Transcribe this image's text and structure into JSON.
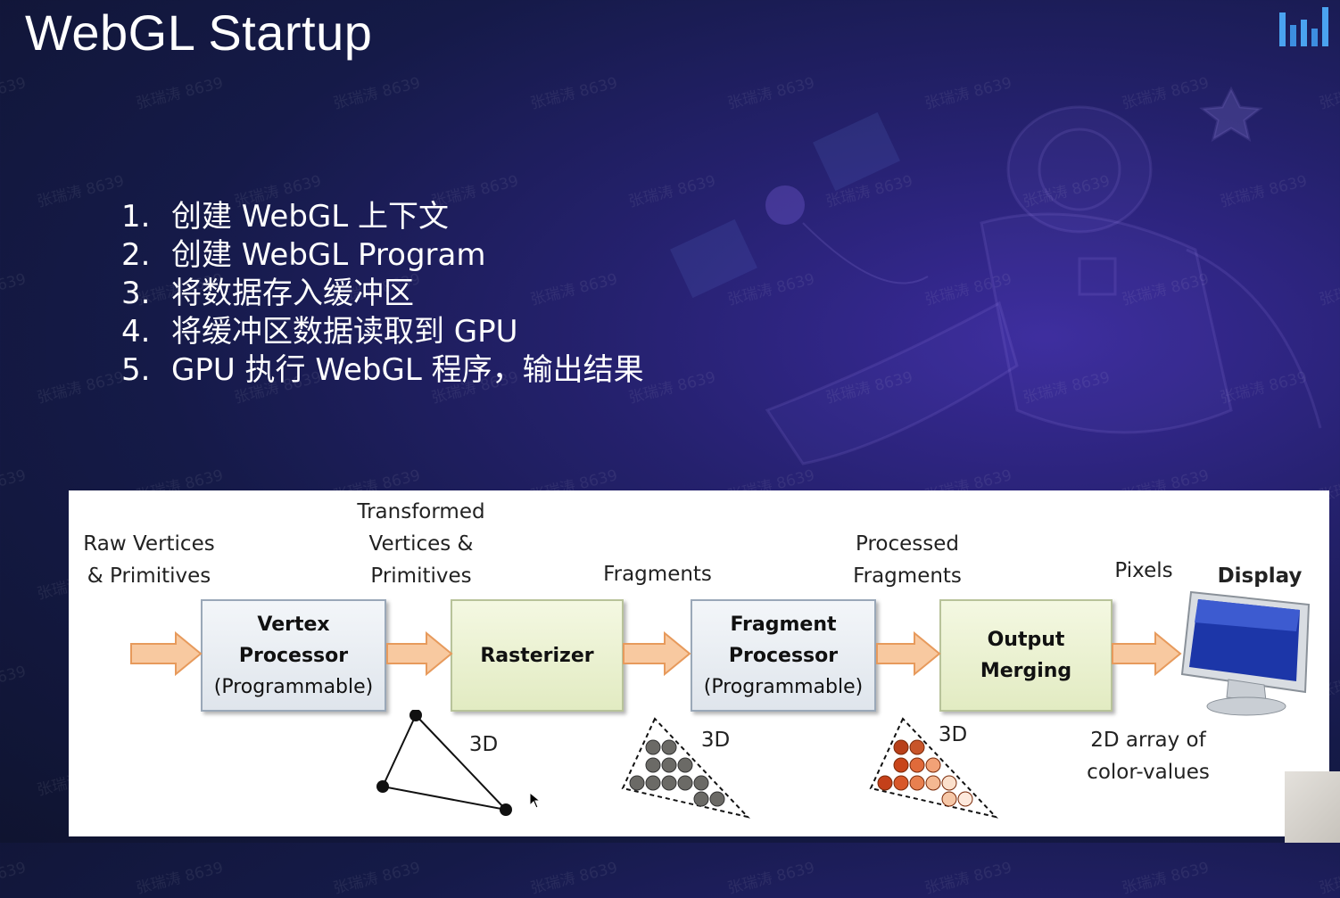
{
  "slide": {
    "title": "WebGL Startup",
    "steps": [
      {
        "num": "1.",
        "text": "创建 WebGL 上下文"
      },
      {
        "num": "2.",
        "text": "创建 WebGL Program"
      },
      {
        "num": "3.",
        "text": "将数据存入缓冲区"
      },
      {
        "num": "4.",
        "text": "将缓冲区数据读取到 GPU"
      },
      {
        "num": "5.",
        "text": "GPU 执行 WebGL 程序，输出结果"
      }
    ],
    "watermark": "张瑞涛 8639"
  },
  "diagram": {
    "labels": {
      "raw": "Raw Vertices\n& Primitives",
      "transformed": "Transformed\nVertices &\nPrimitives",
      "fragments": "Fragments",
      "processed": "Processed\nFragments",
      "pixels": "Pixels",
      "display": "Display",
      "array": "2D array of\ncolor-values",
      "d3_a": "3D",
      "d3_b": "3D",
      "d3_c": "3D"
    },
    "boxes": {
      "vertex_title": "Vertex\nProcessor",
      "vertex_sub": "(Programmable)",
      "rasterizer": "Rasterizer",
      "fragment_title": "Fragment\nProcessor",
      "fragment_sub": "(Programmable)",
      "output": "Output\nMerging"
    }
  },
  "colors": {
    "accent_logo": "#4aa3f0",
    "arrow": "#f5b27a",
    "proc_box": "#e7ecf1",
    "green_box": "#e8eed0"
  }
}
